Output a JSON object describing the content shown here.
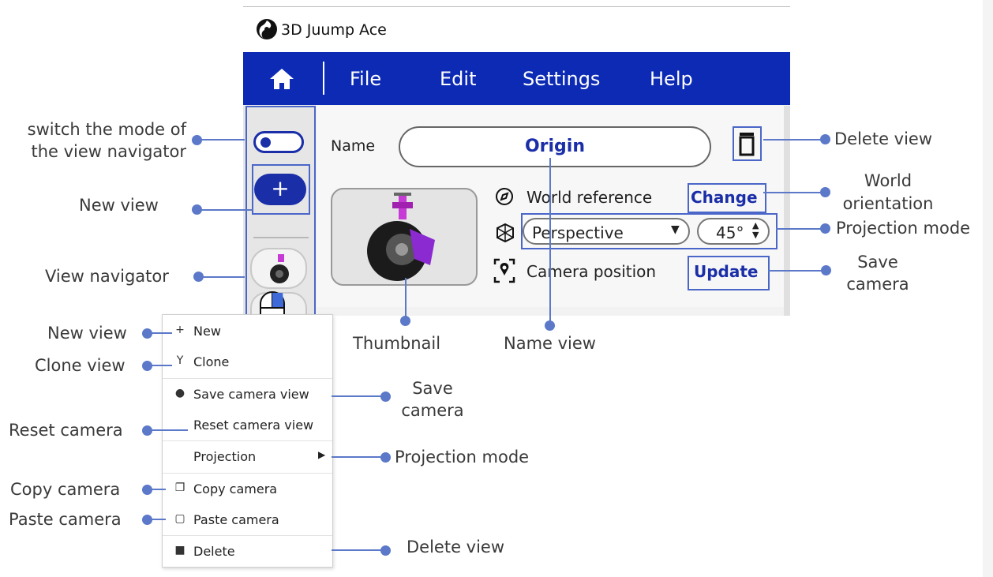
{
  "app": {
    "title": "3D Juump Ace"
  },
  "menu": {
    "items": [
      "File",
      "Edit",
      "Settings",
      "Help"
    ]
  },
  "view": {
    "name_label": "Name",
    "name_value": "Origin",
    "world_reference_label": "World reference",
    "change_button": "Change",
    "projection_value": "Perspective",
    "fov_value": "45°",
    "camera_position_label": "Camera position",
    "update_button": "Update"
  },
  "context_menu": {
    "items": [
      {
        "label": "New",
        "icon": "plus-icon"
      },
      {
        "label": "Clone",
        "icon": "clone-icon"
      },
      {
        "label": "Save camera view",
        "icon": "pin-icon"
      },
      {
        "label": "Reset camera view",
        "icon": ""
      },
      {
        "label": "Projection",
        "icon": "submenu-arrow-icon"
      },
      {
        "label": "Copy camera",
        "icon": "copy-icon"
      },
      {
        "label": "Paste camera",
        "icon": "paste-icon"
      },
      {
        "label": "Delete",
        "icon": "trash-icon"
      }
    ]
  },
  "annotations": {
    "switch_mode": [
      "switch the mode of",
      "the view navigator"
    ],
    "new_view": "New view",
    "view_navigator": "View navigator",
    "thumbnail": "Thumbnail",
    "name_view": "Name view",
    "delete_view": "Delete view",
    "world_orientation": [
      "World",
      "orientation"
    ],
    "projection_mode": "Projection mode",
    "save_camera": [
      "Save",
      "camera"
    ],
    "ctx_new_view": "New view",
    "ctx_clone_view": "Clone view",
    "ctx_save_camera": [
      "Save",
      "camera"
    ],
    "ctx_reset_camera": "Reset camera",
    "ctx_projection_mode": "Projection mode",
    "ctx_copy_camera": "Copy camera",
    "ctx_paste_camera": "Paste camera",
    "ctx_delete_view": "Delete view"
  },
  "colors": {
    "menubar": "#0c2ab4",
    "accent": "#1a2ea8",
    "callout": "#5b78c9"
  }
}
